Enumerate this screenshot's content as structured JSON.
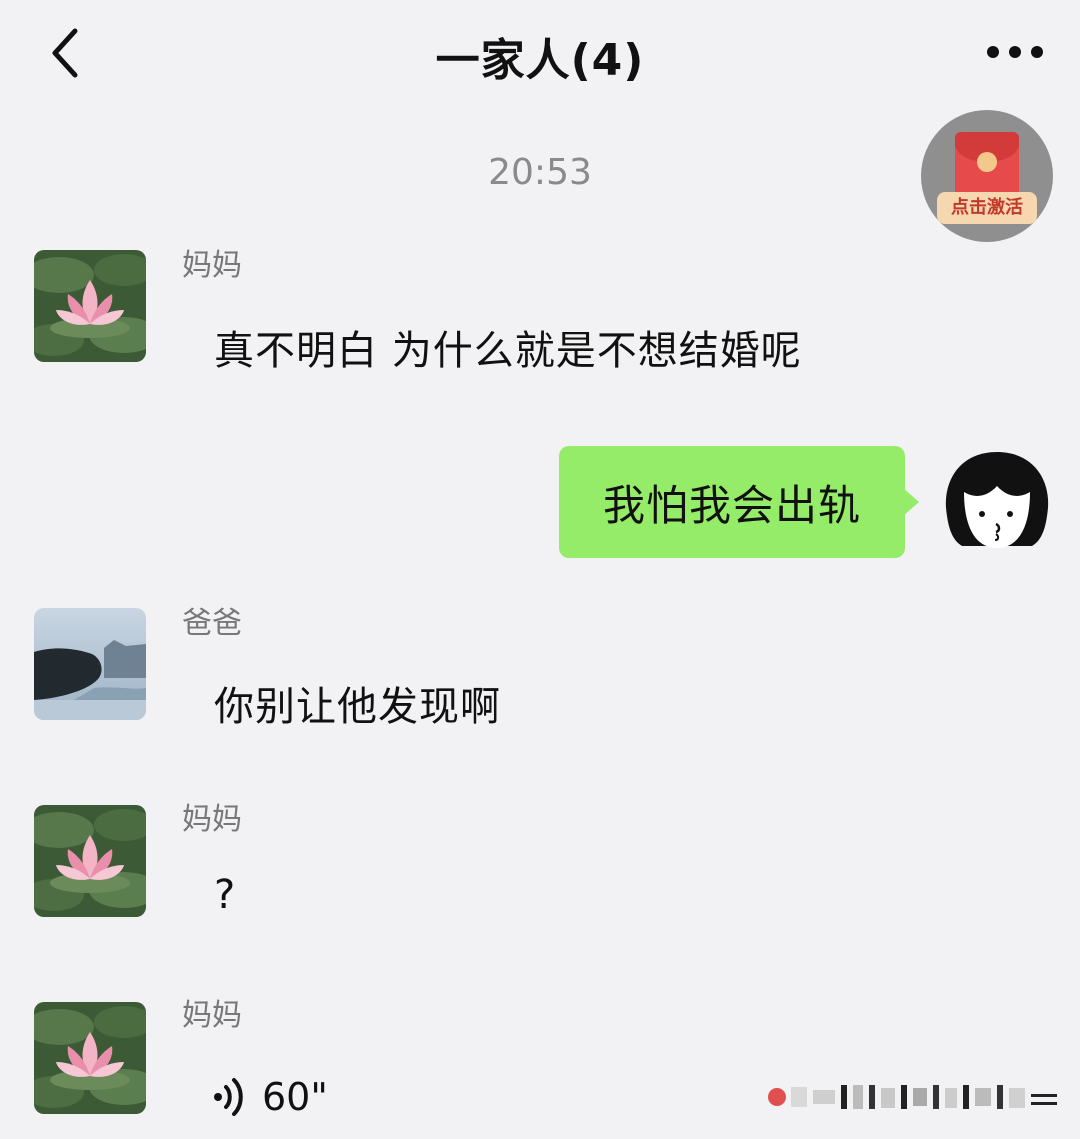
{
  "header": {
    "title": "一家人(4)"
  },
  "timestamp": "20:53",
  "red_packet": {
    "label": "点击激活"
  },
  "messages": [
    {
      "sender": "妈妈",
      "text": "真不明白 为什么就是不想结婚呢"
    },
    {
      "text": "我怕我会出轨"
    },
    {
      "sender": "爸爸",
      "text": "你别让他发现啊"
    },
    {
      "sender": "妈妈",
      "text": "?"
    },
    {
      "sender": "妈妈",
      "voice_duration": "60\""
    }
  ]
}
